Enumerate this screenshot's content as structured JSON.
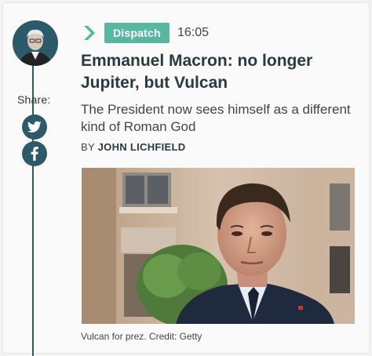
{
  "sidebar": {
    "share_label": "Share:",
    "share_buttons": [
      {
        "icon": "twitter-icon"
      },
      {
        "icon": "facebook-icon"
      }
    ],
    "accent_color": "#2d5a6b"
  },
  "article": {
    "type_badge": "Dispatch",
    "badge_color": "#57b89f",
    "time": "16:05",
    "headline": "Emmanuel Macron: no longer Jupiter, but Vulcan",
    "subheadline": "The President now sees himself as a different kind of Roman God",
    "byline_prefix": "BY",
    "author": "JOHN LICHFIELD",
    "image_caption": "Vulcan for prez. Credit: Getty"
  }
}
